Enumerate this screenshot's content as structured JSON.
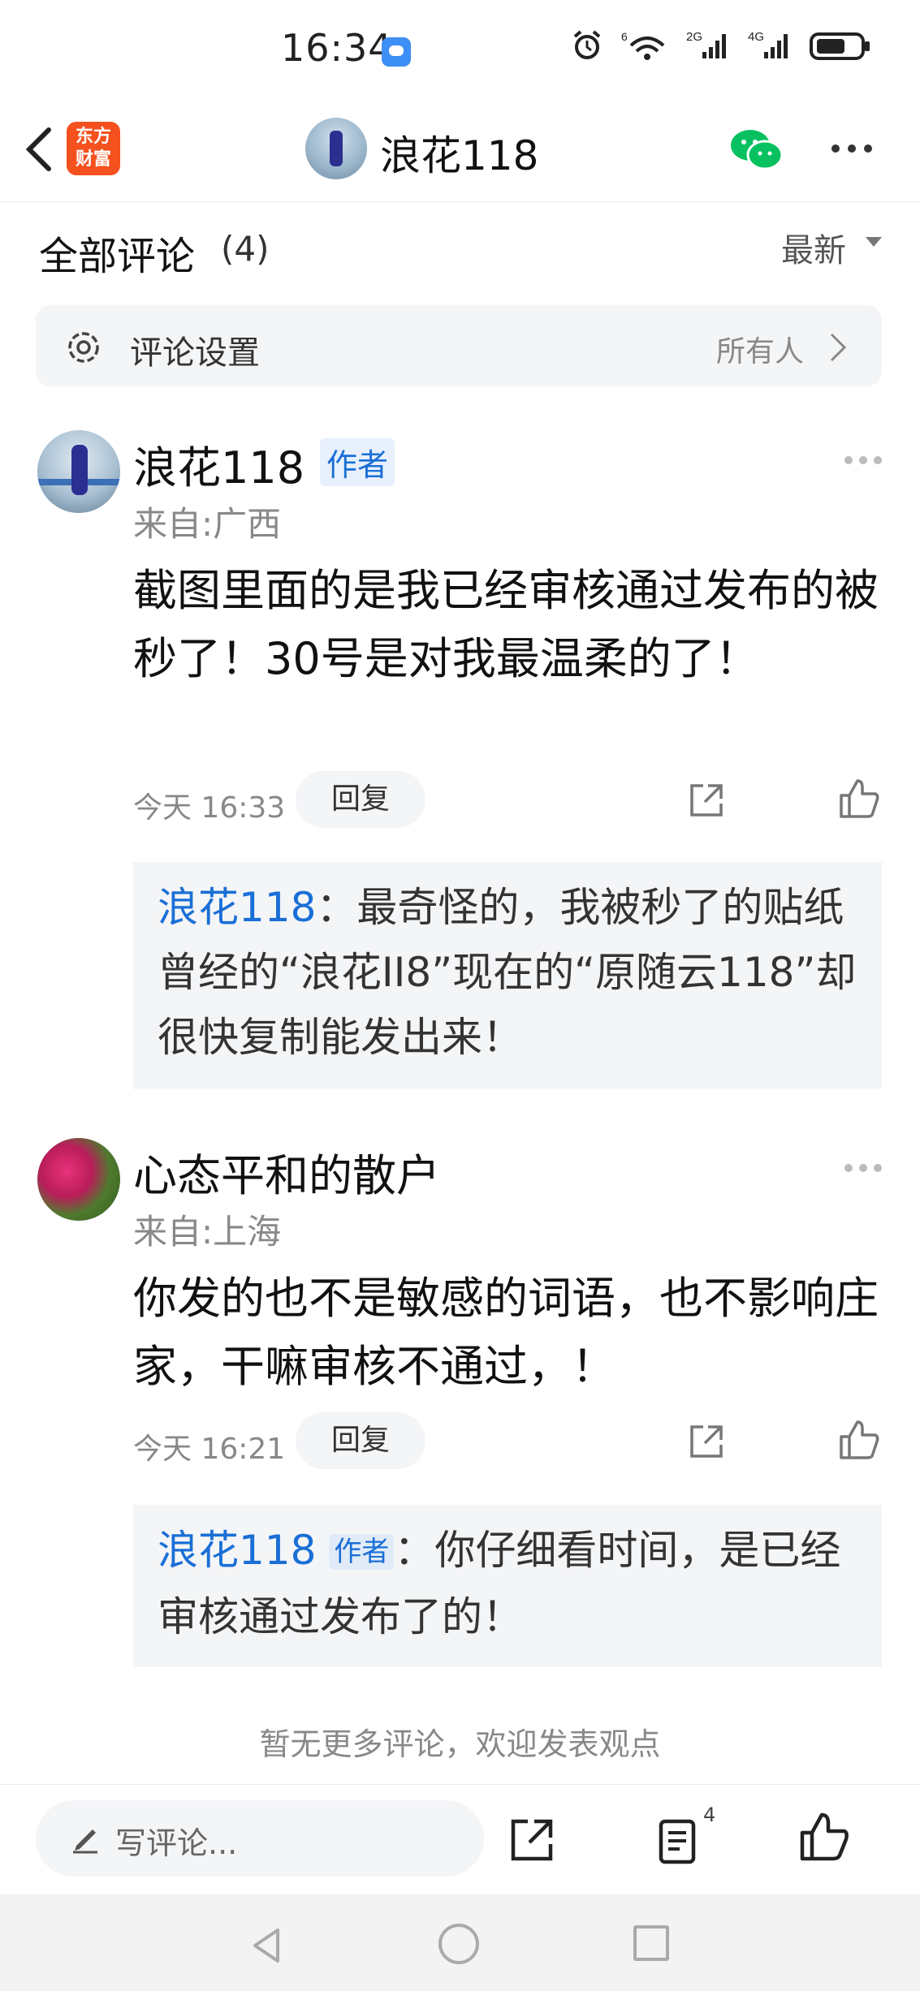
{
  "status_bar": {
    "time": "16:34",
    "network_1": "6",
    "network_2": "2G",
    "network_3": "4G"
  },
  "nav": {
    "title": "浪花118",
    "app_logo_line1": "东方",
    "app_logo_line2": "财富"
  },
  "comments_header": {
    "title": "全部评论",
    "count": "(4)",
    "sort_label": "最新"
  },
  "settings": {
    "label": "评论设置",
    "value": "所有人"
  },
  "comments": [
    {
      "name": "浪花118",
      "tag": "作者",
      "from": "来自:广西",
      "content": "截图里面的是我已经审核通过发布的被秒了！30号是对我最温柔的了！",
      "time": "今天 16:33",
      "reply_label": "回复",
      "reply": {
        "name": "浪花118",
        "tag": "",
        "text": "：最奇怪的，我被秒了的贴纸曾经的“浪花II8”现在的“原随云118”却很快复制能发出来！"
      }
    },
    {
      "name": "心态平和的散户",
      "tag": "",
      "from": "来自:上海",
      "content": "你发的也不是敏感的词语，也不影响庄家，干嘛审核不通过，！",
      "time": "今天 16:21",
      "reply_label": "回复",
      "reply": {
        "name": "浪花118",
        "tag": "作者",
        "text": "：你仔细看时间，是已经审核通过发布了的！"
      }
    }
  ],
  "footer_note": "暂无更多评论，欢迎发表观点",
  "bottom_bar": {
    "write_placeholder": "写评论...",
    "comment_count": "4"
  },
  "colors": {
    "accent_blue": "#1a6fd6",
    "logo_orange": "#f4511e",
    "wechat_green": "#07c160"
  }
}
